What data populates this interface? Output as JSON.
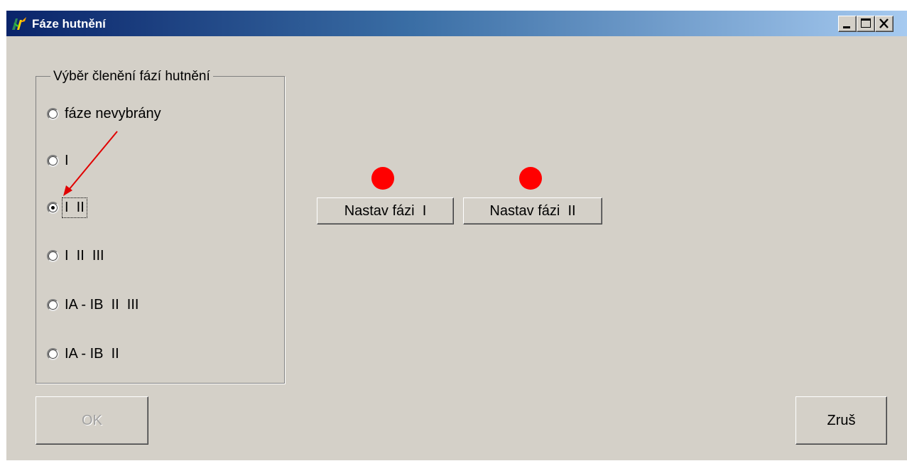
{
  "window": {
    "title": "Fáze hutnění",
    "controls": [
      "minimize-icon",
      "maximize-icon",
      "close-icon"
    ]
  },
  "group": {
    "title": "Výběr členění fází hutnění",
    "options": [
      {
        "label": "fáze nevybrány",
        "selected": false
      },
      {
        "label": "I",
        "selected": false
      },
      {
        "label": "I  II",
        "selected": true
      },
      {
        "label": "I  II  III",
        "selected": false
      },
      {
        "label": "IA - IB  II  III",
        "selected": false
      },
      {
        "label": "IA - IB  II",
        "selected": false
      }
    ]
  },
  "phase_buttons": [
    {
      "label": "Nastav fázi  I",
      "indicator_color": "#ff0000"
    },
    {
      "label": "Nastav fázi  II",
      "indicator_color": "#ff0000"
    }
  ],
  "footer": {
    "ok_label": "OK",
    "ok_enabled": false,
    "cancel_label": "Zruš"
  },
  "colors": {
    "face": "#d4d0c8",
    "titlebar_start": "#0a246a",
    "titlebar_end": "#a6caf0",
    "annotation_arrow": "#e00000"
  }
}
